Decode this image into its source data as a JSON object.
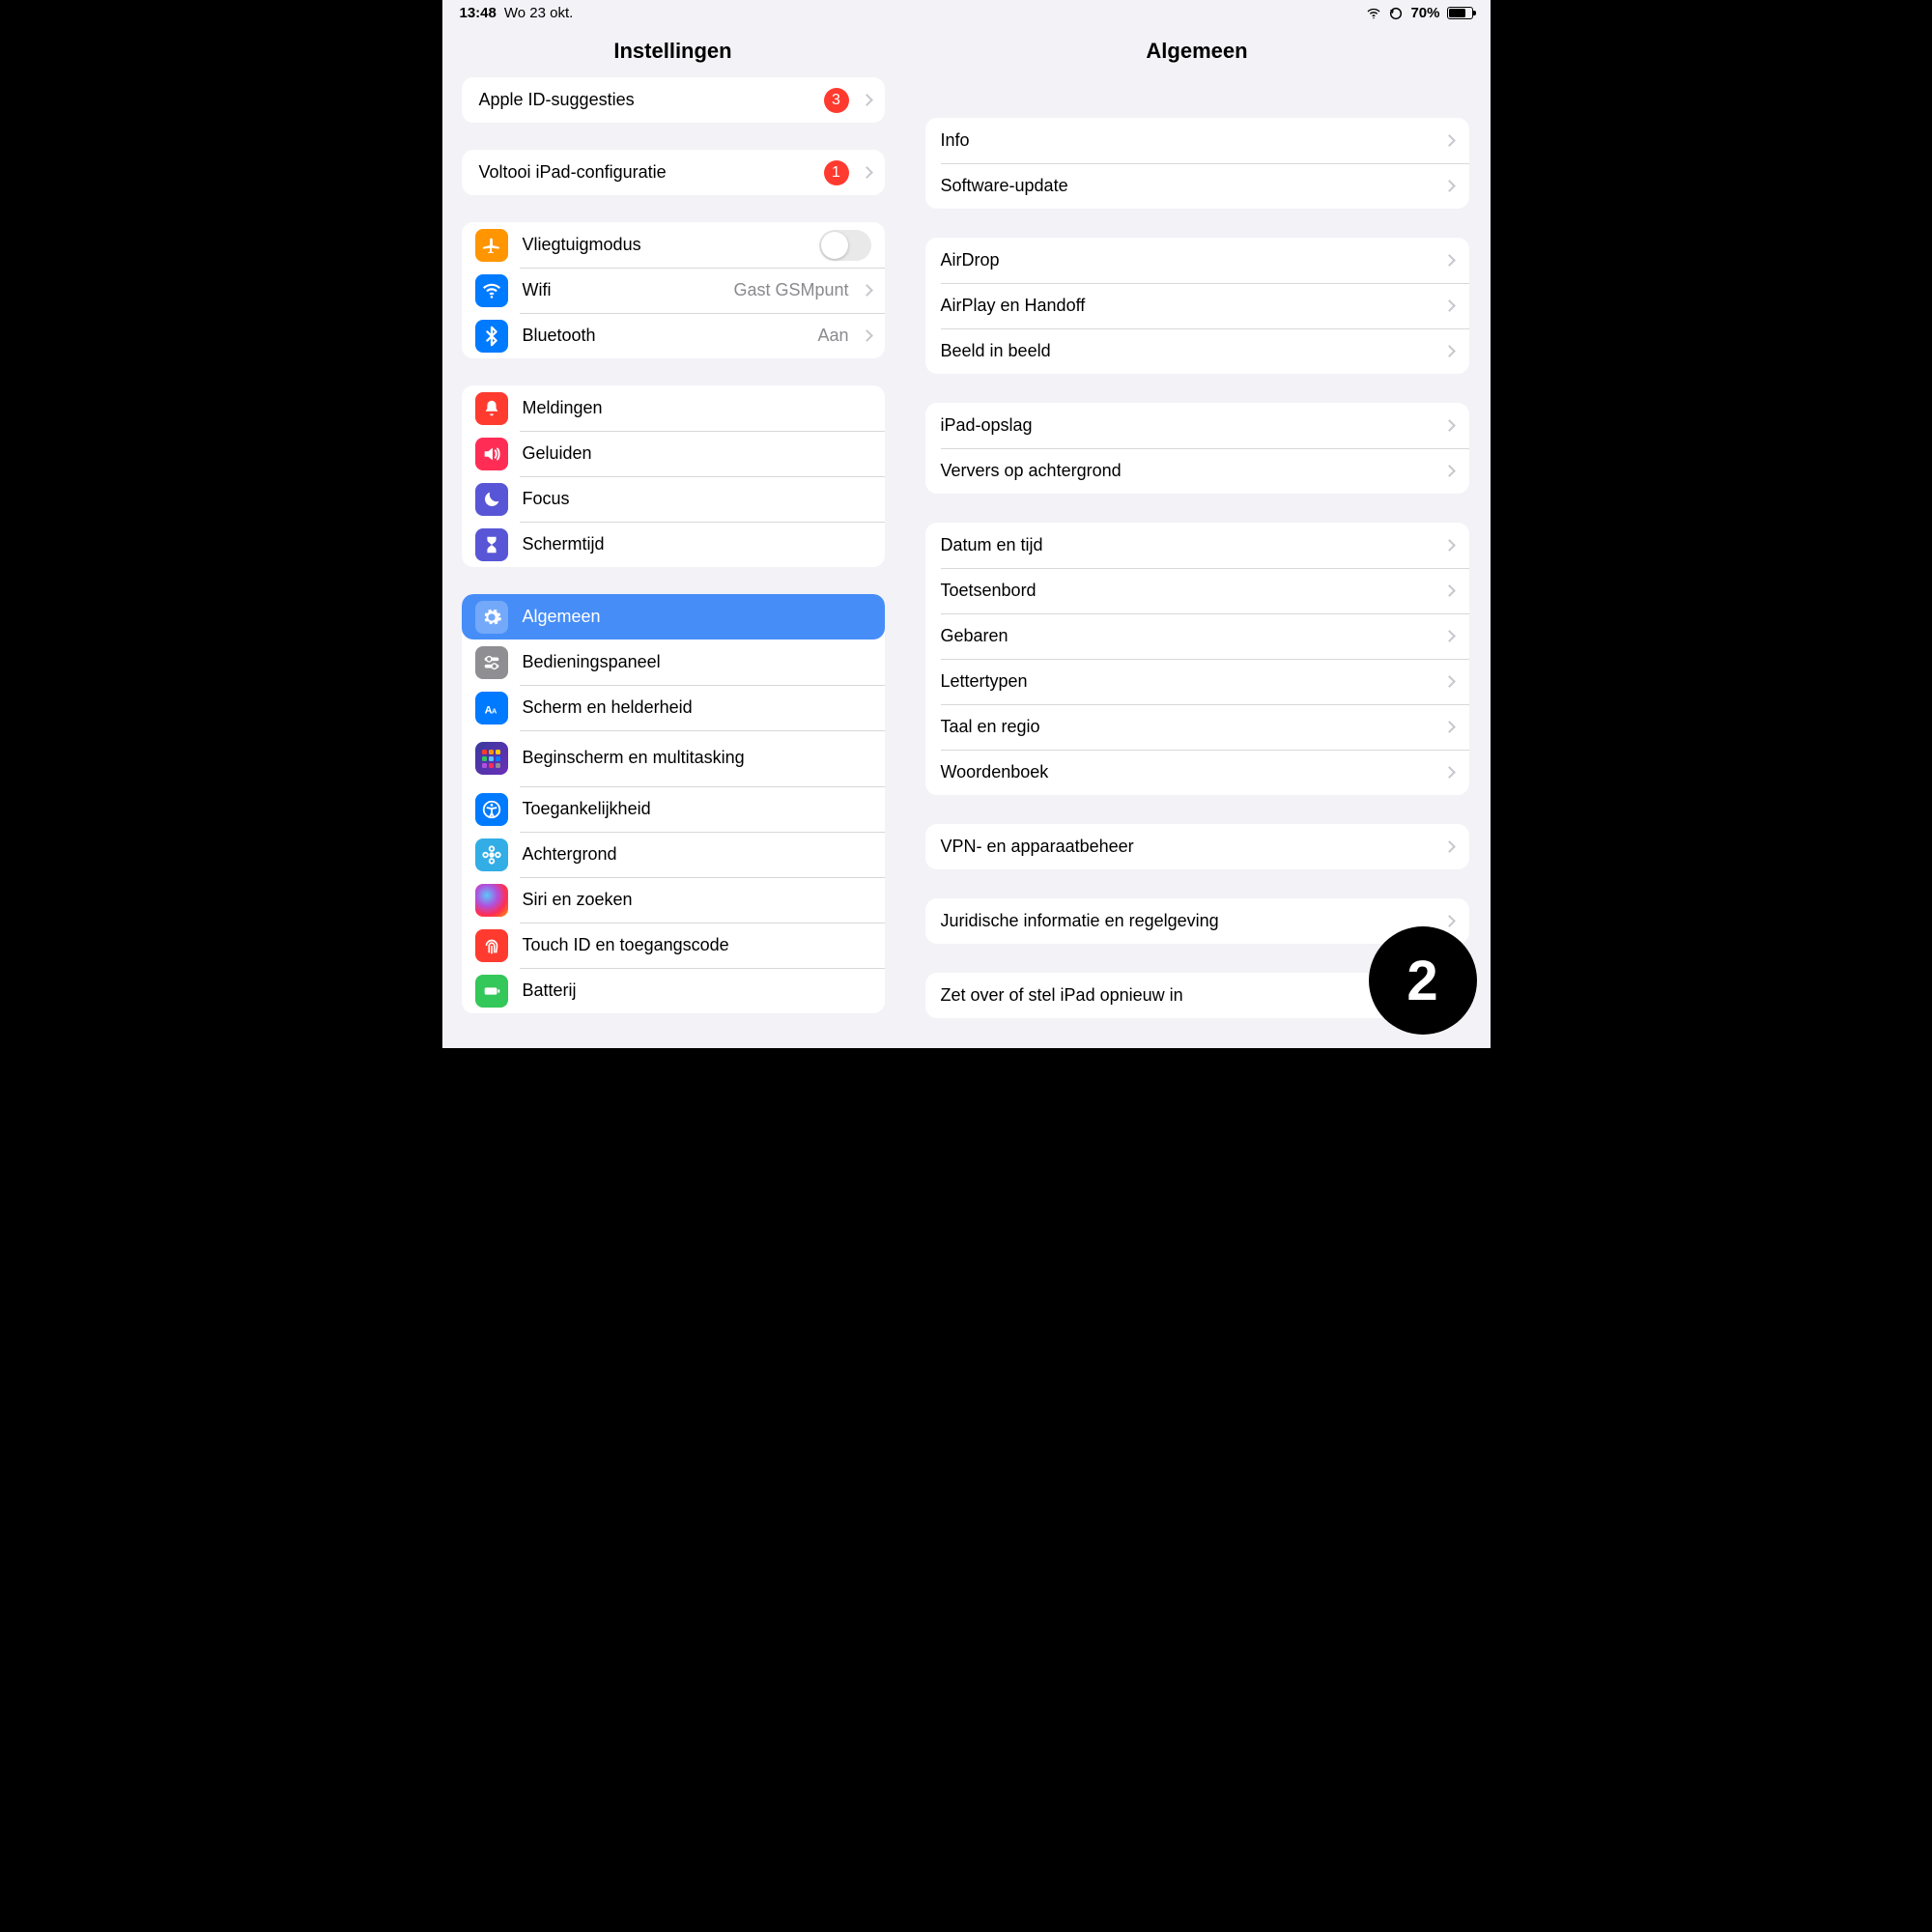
{
  "status": {
    "time": "13:48",
    "date": "Wo 23 okt.",
    "battery_pct": "70%"
  },
  "sidebar": {
    "title": "Instellingen",
    "apple_id": {
      "label": "Apple ID-suggesties",
      "badge": "3"
    },
    "finish_setup": {
      "label": "Voltooi iPad-configuratie",
      "badge": "1"
    },
    "connectivity": {
      "airplane": "Vliegtuigmodus",
      "wifi_label": "Wifi",
      "wifi_value": "Gast GSMpunt",
      "bluetooth_label": "Bluetooth",
      "bluetooth_value": "Aan"
    },
    "notif_group": {
      "notifications": "Meldingen",
      "sounds": "Geluiden",
      "focus": "Focus",
      "screentime": "Schermtijd"
    },
    "system_group": {
      "general": "Algemeen",
      "control_center": "Bedieningspaneel",
      "display": "Scherm en helderheid",
      "homescreen": "Beginscherm en multitasking",
      "accessibility": "Toegankelijkheid",
      "wallpaper": "Achtergrond",
      "siri": "Siri en zoeken",
      "touchid": "Touch ID en toegangscode",
      "battery": "Batterij"
    }
  },
  "detail": {
    "title": "Algemeen",
    "g1": {
      "info": "Info",
      "software_update": "Software-update"
    },
    "g2": {
      "airdrop": "AirDrop",
      "airplay": "AirPlay en Handoff",
      "pip": "Beeld in beeld"
    },
    "g3": {
      "storage": "iPad-opslag",
      "background": "Ververs op achtergrond"
    },
    "g4": {
      "date": "Datum en tijd",
      "keyboard": "Toetsenbord",
      "gestures": "Gebaren",
      "fonts": "Lettertypen",
      "language": "Taal en regio",
      "dictionary": "Woordenboek"
    },
    "g5": {
      "vpn": "VPN- en apparaatbeheer"
    },
    "g6": {
      "legal": "Juridische informatie en regelgeving"
    },
    "g7": {
      "transfer": "Zet over of stel iPad opnieuw in"
    }
  },
  "step": "2"
}
